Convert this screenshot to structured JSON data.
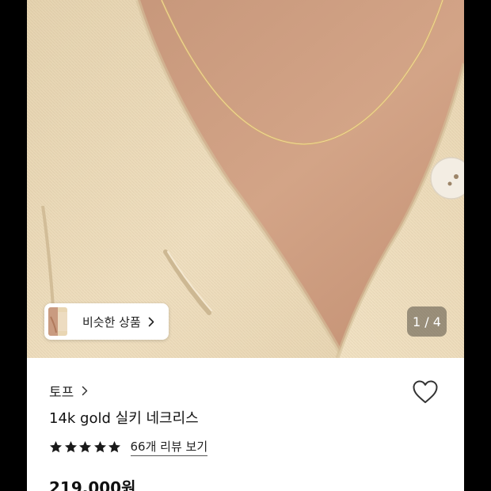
{
  "gallery": {
    "page_indicator": "1 / 4",
    "similar_button_label": "비슷한 상품"
  },
  "product": {
    "brand": "토프",
    "name": "14k gold 실키 네크리스",
    "rating_stars": 5,
    "review_link": "66개 리뷰 보기",
    "price": "219,000원"
  },
  "icons": {
    "similar_chevron": "chevron-right-icon",
    "brand_chevron": "chevron-right-icon",
    "wishlist": "heart-outline-icon",
    "rating": "star-icon"
  },
  "colors": {
    "star": "#1a1a1a",
    "page_indicator_bg": "#595048"
  }
}
